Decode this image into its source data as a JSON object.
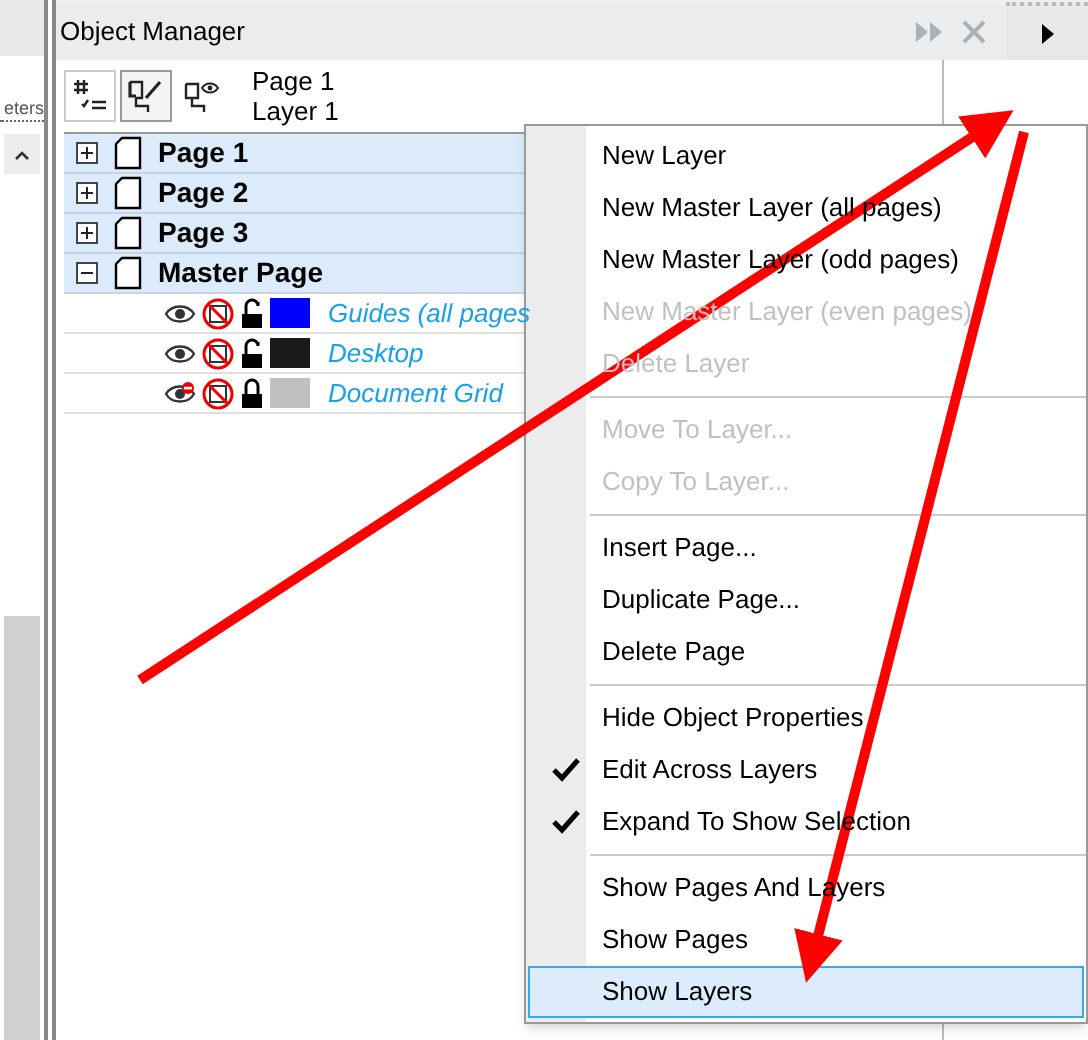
{
  "side_panel": {
    "label": "eters"
  },
  "object_manager": {
    "title": "Object Manager",
    "current_page": "Page 1",
    "current_layer": "Layer 1",
    "pages": [
      {
        "name": "Page 1",
        "expanded": false
      },
      {
        "name": "Page 2",
        "expanded": false
      },
      {
        "name": "Page 3",
        "expanded": false
      },
      {
        "name": "Master Page",
        "expanded": true,
        "children": [
          {
            "name": "Guides (all pages",
            "visible": true,
            "locked": false,
            "color": "#0000ff"
          },
          {
            "name": "Desktop",
            "visible": true,
            "locked": false,
            "color": "#1a1a1a"
          },
          {
            "name": "Document Grid",
            "visible": false,
            "locked": true,
            "color": "#c0c0c0"
          }
        ]
      }
    ]
  },
  "menu": [
    {
      "kind": "item",
      "label": "New Layer",
      "disabled": false,
      "checked": false,
      "selected": false
    },
    {
      "kind": "item",
      "label": "New Master Layer (all pages)",
      "disabled": false,
      "checked": false,
      "selected": false
    },
    {
      "kind": "item",
      "label": "New Master Layer (odd pages)",
      "disabled": false,
      "checked": false,
      "selected": false
    },
    {
      "kind": "item",
      "label": "New Master Layer (even pages)",
      "disabled": true,
      "checked": false,
      "selected": false
    },
    {
      "kind": "item",
      "label": "Delete Layer",
      "disabled": true,
      "checked": false,
      "selected": false
    },
    {
      "kind": "separator"
    },
    {
      "kind": "item",
      "label": "Move To Layer...",
      "disabled": true,
      "checked": false,
      "selected": false
    },
    {
      "kind": "item",
      "label": "Copy To Layer...",
      "disabled": true,
      "checked": false,
      "selected": false
    },
    {
      "kind": "separator"
    },
    {
      "kind": "item",
      "label": "Insert Page...",
      "disabled": false,
      "checked": false,
      "selected": false
    },
    {
      "kind": "item",
      "label": "Duplicate Page...",
      "disabled": false,
      "checked": false,
      "selected": false
    },
    {
      "kind": "item",
      "label": "Delete Page",
      "disabled": false,
      "checked": false,
      "selected": false
    },
    {
      "kind": "separator"
    },
    {
      "kind": "item",
      "label": "Hide Object Properties",
      "disabled": false,
      "checked": false,
      "selected": false
    },
    {
      "kind": "item",
      "label": "Edit Across Layers",
      "disabled": false,
      "checked": true,
      "selected": false
    },
    {
      "kind": "item",
      "label": "Expand To Show Selection",
      "disabled": false,
      "checked": true,
      "selected": false
    },
    {
      "kind": "separator"
    },
    {
      "kind": "item",
      "label": "Show Pages And Layers",
      "disabled": false,
      "checked": false,
      "selected": false
    },
    {
      "kind": "item",
      "label": "Show Pages",
      "disabled": false,
      "checked": false,
      "selected": false
    },
    {
      "kind": "item",
      "label": "Show Layers",
      "disabled": false,
      "checked": false,
      "selected": true
    }
  ]
}
